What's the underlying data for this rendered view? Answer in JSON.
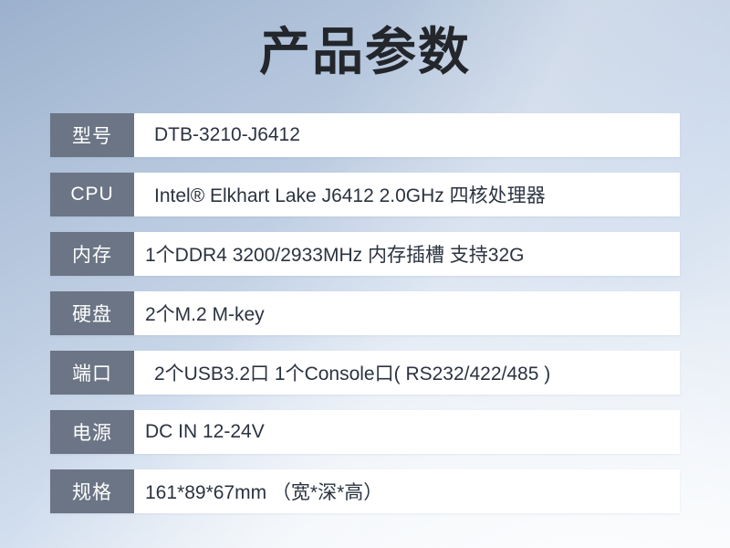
{
  "page": {
    "title": "产品参数",
    "background_top_left": "#9cb1cd",
    "background_bottom_right": "#eef3f8",
    "label_cell_color": "#6b7585",
    "value_cell_color": "#ffffff",
    "value_text_color": "#2b3340",
    "title_color": "#23272c"
  },
  "spec_rows": [
    {
      "label": "型号",
      "value": "DTB-3210-J6412"
    },
    {
      "label": "CPU",
      "value": "Intel® Elkhart Lake J6412 2.0GHz 四核处理器"
    },
    {
      "label": "内存",
      "value": "1个DDR4 3200/2933MHz 内存插槽 支持32G"
    },
    {
      "label": "硬盘",
      "value": "2个M.2 M-key"
    },
    {
      "label": "端口",
      "value": "2个USB3.2口 1个Console口( RS232/422/485 )"
    },
    {
      "label": "电源",
      "value": "DC IN 12-24V"
    },
    {
      "label": "规格",
      "value": "161*89*67mm （宽*深*高）"
    }
  ]
}
